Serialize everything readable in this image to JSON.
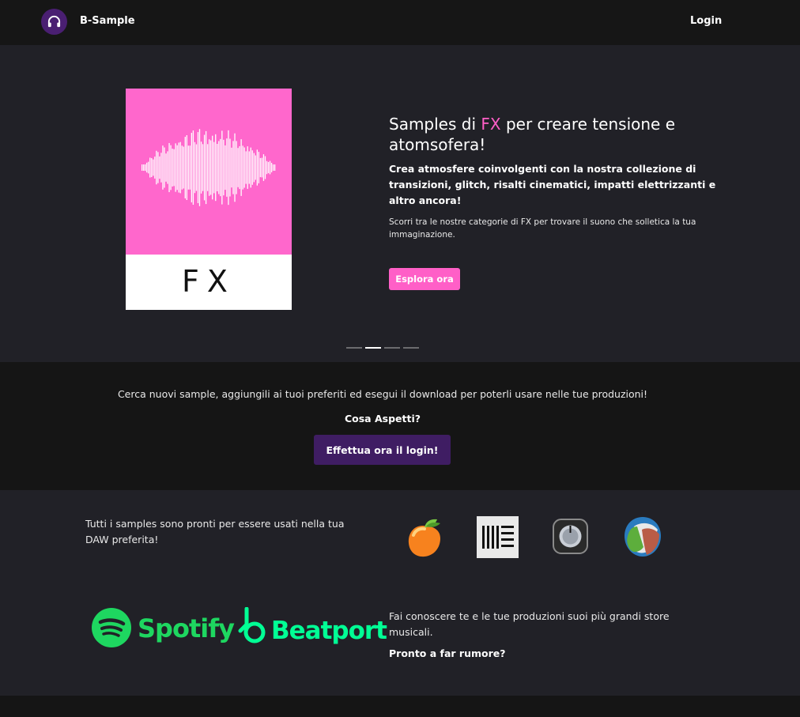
{
  "nav": {
    "brand": "B-Sample",
    "login_label": "Login"
  },
  "hero": {
    "cover_label": "FX",
    "title_pre": "Samples di ",
    "title_accent": "FX",
    "title_post": " per creare tensione e atomsofera!",
    "lead": "Crea atmosfere coinvolgenti con la nostra collezione di transizioni, glitch, risalti cinematici, impatti elettrizzanti e altro ancora!",
    "sub": "Scorri tra le nostre categorie di FX per trovare il suono che solletica la tua immaginazione.",
    "cta_label": "Esplora ora",
    "carousel_active_index": 1,
    "carousel_count": 4
  },
  "cta": {
    "text": "Cerca nuovi sample, aggiungili ai tuoi preferiti ed esegui il download per poterli usare nelle tue produzioni!",
    "question": "Cosa Aspetti?",
    "button_label": "Effettua ora il login!"
  },
  "daw": {
    "text": "Tutti i samples sono pronti per essere usati nella tua DAW preferita!",
    "icons": [
      "fl-studio-icon",
      "ableton-live-icon",
      "logic-pro-icon",
      "reaper-icon"
    ]
  },
  "stores": {
    "spotify": "Spotify",
    "beatport": "Beatport",
    "text": "Fai conoscere te e le tue produzioni suoi più grandi store musicali.",
    "question": "Pronto a far rumore?"
  },
  "colors": {
    "accent_pink": "#ff5fc7",
    "cover_pink": "#ff67cc",
    "brand_purple": "#4a1f72",
    "login_button": "#3f1d63",
    "spotify_green": "#1ed760",
    "beatport_green": "#01ff95"
  }
}
